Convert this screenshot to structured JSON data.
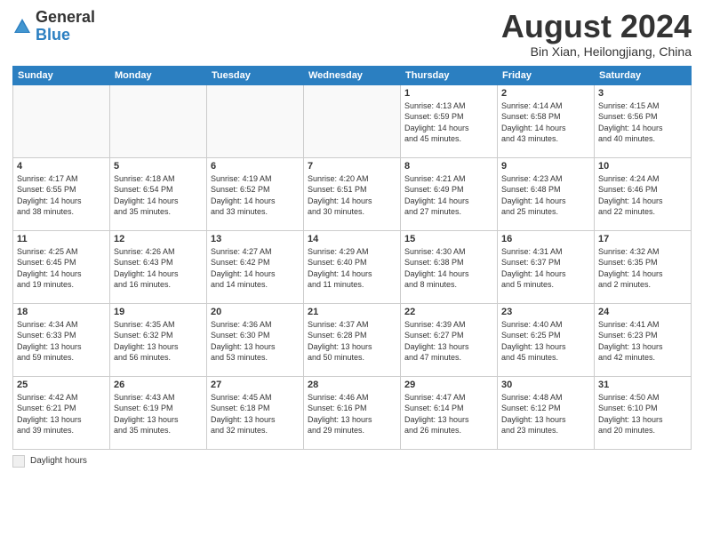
{
  "header": {
    "logo_general": "General",
    "logo_blue": "Blue",
    "month_title": "August 2024",
    "location": "Bin Xian, Heilongjiang, China"
  },
  "weekdays": [
    "Sunday",
    "Monday",
    "Tuesday",
    "Wednesday",
    "Thursday",
    "Friday",
    "Saturday"
  ],
  "weeks": [
    [
      {
        "day": "",
        "info": ""
      },
      {
        "day": "",
        "info": ""
      },
      {
        "day": "",
        "info": ""
      },
      {
        "day": "",
        "info": ""
      },
      {
        "day": "1",
        "info": "Sunrise: 4:13 AM\nSunset: 6:59 PM\nDaylight: 14 hours\nand 45 minutes."
      },
      {
        "day": "2",
        "info": "Sunrise: 4:14 AM\nSunset: 6:58 PM\nDaylight: 14 hours\nand 43 minutes."
      },
      {
        "day": "3",
        "info": "Sunrise: 4:15 AM\nSunset: 6:56 PM\nDaylight: 14 hours\nand 40 minutes."
      }
    ],
    [
      {
        "day": "4",
        "info": "Sunrise: 4:17 AM\nSunset: 6:55 PM\nDaylight: 14 hours\nand 38 minutes."
      },
      {
        "day": "5",
        "info": "Sunrise: 4:18 AM\nSunset: 6:54 PM\nDaylight: 14 hours\nand 35 minutes."
      },
      {
        "day": "6",
        "info": "Sunrise: 4:19 AM\nSunset: 6:52 PM\nDaylight: 14 hours\nand 33 minutes."
      },
      {
        "day": "7",
        "info": "Sunrise: 4:20 AM\nSunset: 6:51 PM\nDaylight: 14 hours\nand 30 minutes."
      },
      {
        "day": "8",
        "info": "Sunrise: 4:21 AM\nSunset: 6:49 PM\nDaylight: 14 hours\nand 27 minutes."
      },
      {
        "day": "9",
        "info": "Sunrise: 4:23 AM\nSunset: 6:48 PM\nDaylight: 14 hours\nand 25 minutes."
      },
      {
        "day": "10",
        "info": "Sunrise: 4:24 AM\nSunset: 6:46 PM\nDaylight: 14 hours\nand 22 minutes."
      }
    ],
    [
      {
        "day": "11",
        "info": "Sunrise: 4:25 AM\nSunset: 6:45 PM\nDaylight: 14 hours\nand 19 minutes."
      },
      {
        "day": "12",
        "info": "Sunrise: 4:26 AM\nSunset: 6:43 PM\nDaylight: 14 hours\nand 16 minutes."
      },
      {
        "day": "13",
        "info": "Sunrise: 4:27 AM\nSunset: 6:42 PM\nDaylight: 14 hours\nand 14 minutes."
      },
      {
        "day": "14",
        "info": "Sunrise: 4:29 AM\nSunset: 6:40 PM\nDaylight: 14 hours\nand 11 minutes."
      },
      {
        "day": "15",
        "info": "Sunrise: 4:30 AM\nSunset: 6:38 PM\nDaylight: 14 hours\nand 8 minutes."
      },
      {
        "day": "16",
        "info": "Sunrise: 4:31 AM\nSunset: 6:37 PM\nDaylight: 14 hours\nand 5 minutes."
      },
      {
        "day": "17",
        "info": "Sunrise: 4:32 AM\nSunset: 6:35 PM\nDaylight: 14 hours\nand 2 minutes."
      }
    ],
    [
      {
        "day": "18",
        "info": "Sunrise: 4:34 AM\nSunset: 6:33 PM\nDaylight: 13 hours\nand 59 minutes."
      },
      {
        "day": "19",
        "info": "Sunrise: 4:35 AM\nSunset: 6:32 PM\nDaylight: 13 hours\nand 56 minutes."
      },
      {
        "day": "20",
        "info": "Sunrise: 4:36 AM\nSunset: 6:30 PM\nDaylight: 13 hours\nand 53 minutes."
      },
      {
        "day": "21",
        "info": "Sunrise: 4:37 AM\nSunset: 6:28 PM\nDaylight: 13 hours\nand 50 minutes."
      },
      {
        "day": "22",
        "info": "Sunrise: 4:39 AM\nSunset: 6:27 PM\nDaylight: 13 hours\nand 47 minutes."
      },
      {
        "day": "23",
        "info": "Sunrise: 4:40 AM\nSunset: 6:25 PM\nDaylight: 13 hours\nand 45 minutes."
      },
      {
        "day": "24",
        "info": "Sunrise: 4:41 AM\nSunset: 6:23 PM\nDaylight: 13 hours\nand 42 minutes."
      }
    ],
    [
      {
        "day": "25",
        "info": "Sunrise: 4:42 AM\nSunset: 6:21 PM\nDaylight: 13 hours\nand 39 minutes."
      },
      {
        "day": "26",
        "info": "Sunrise: 4:43 AM\nSunset: 6:19 PM\nDaylight: 13 hours\nand 35 minutes."
      },
      {
        "day": "27",
        "info": "Sunrise: 4:45 AM\nSunset: 6:18 PM\nDaylight: 13 hours\nand 32 minutes."
      },
      {
        "day": "28",
        "info": "Sunrise: 4:46 AM\nSunset: 6:16 PM\nDaylight: 13 hours\nand 29 minutes."
      },
      {
        "day": "29",
        "info": "Sunrise: 4:47 AM\nSunset: 6:14 PM\nDaylight: 13 hours\nand 26 minutes."
      },
      {
        "day": "30",
        "info": "Sunrise: 4:48 AM\nSunset: 6:12 PM\nDaylight: 13 hours\nand 23 minutes."
      },
      {
        "day": "31",
        "info": "Sunrise: 4:50 AM\nSunset: 6:10 PM\nDaylight: 13 hours\nand 20 minutes."
      }
    ]
  ],
  "legend": {
    "box_label": "Daylight hours"
  }
}
